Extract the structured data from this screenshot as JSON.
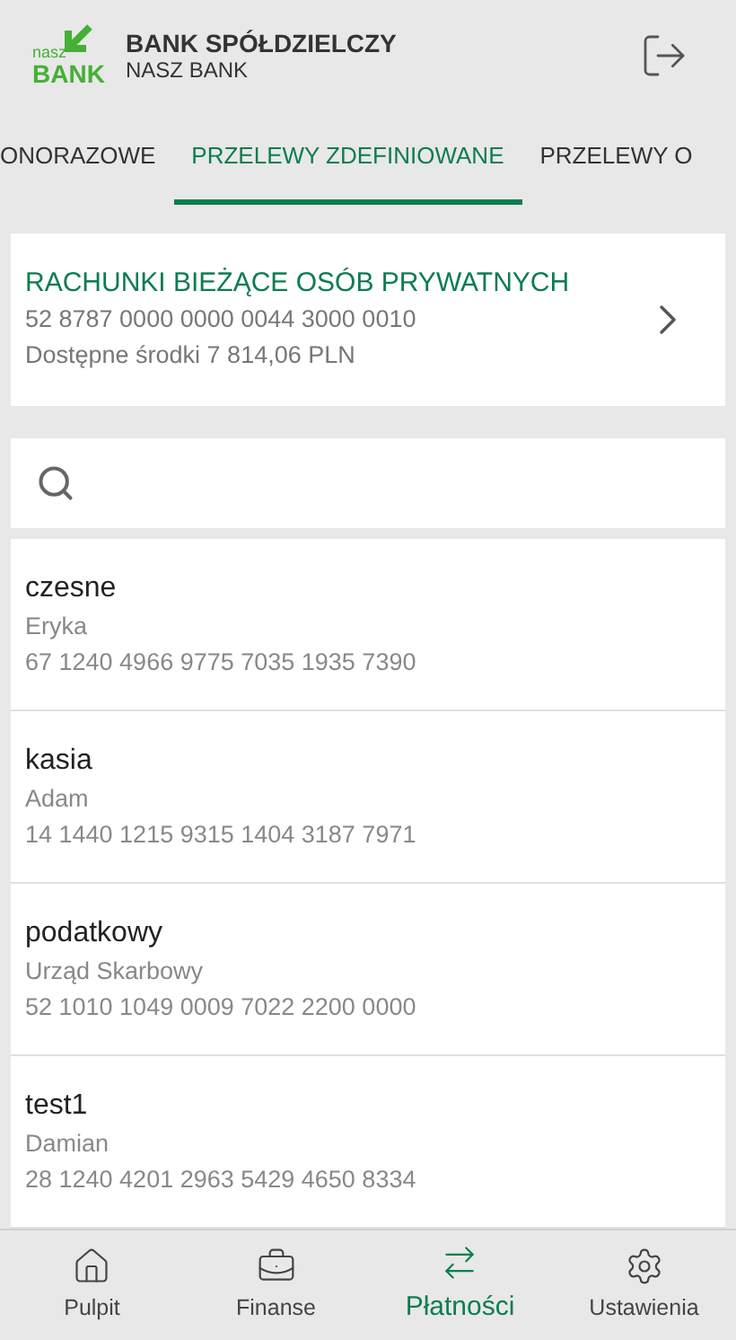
{
  "header": {
    "logo_top": "nasz",
    "logo_bottom": "BANK",
    "title": "BANK SPÓŁDZIELCZY",
    "subtitle": "NASZ BANK"
  },
  "tabs": [
    {
      "label": "ONORAZOWE",
      "selected": false
    },
    {
      "label": "PRZELEWY ZDEFINIOWANE",
      "selected": true
    },
    {
      "label": "PRZELEWY O",
      "selected": false
    }
  ],
  "account": {
    "name": "RACHUNKI BIEŻĄCE OSÓB PRYWATNYCH",
    "number": "52 8787 0000 0000 0044 3000 0010",
    "balance": "Dostępne środki 7 814,06 PLN"
  },
  "transfers": [
    {
      "title": "czesne",
      "recipient": "Eryka",
      "account": "67 1240 4966 9775 7035 1935 7390"
    },
    {
      "title": "kasia",
      "recipient": "Adam",
      "account": "14 1440 1215 9315 1404 3187 7971"
    },
    {
      "title": "podatkowy",
      "recipient": "Urząd Skarbowy",
      "account": "52 1010 1049 0009 7022 2200 0000"
    },
    {
      "title": "test1",
      "recipient": "Damian",
      "account": "28 1240 4201 2963 5429 4650 8334"
    }
  ],
  "nav": [
    {
      "label": "Pulpit",
      "kind": "home",
      "selected": false
    },
    {
      "label": "Finanse",
      "kind": "finance",
      "selected": false
    },
    {
      "label": "Płatności",
      "kind": "payments",
      "selected": true
    },
    {
      "label": "Ustawienia",
      "kind": "settings",
      "selected": false
    }
  ]
}
